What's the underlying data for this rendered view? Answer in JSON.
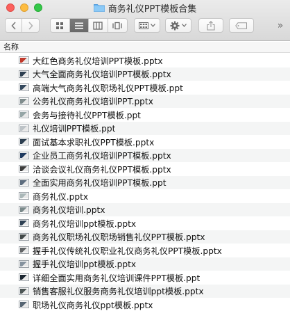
{
  "window": {
    "title": "商务礼仪PPT模板合集",
    "close_label": "close",
    "minimize_label": "minimize",
    "zoom_label": "zoom"
  },
  "toolbar": {
    "back_icon": "chevron-left-icon",
    "forward_icon": "chevron-right-icon",
    "view_modes": [
      "icon-view-icon",
      "list-view-icon",
      "column-view-icon",
      "cover-flow-icon"
    ],
    "active_view": "list",
    "arrange_icon": "arrange-grid-icon",
    "action_icon": "gear-icon",
    "share_icon": "share-icon",
    "tags_icon": "tag-icon",
    "overflow_label": "»"
  },
  "columns": {
    "name_header": "名称"
  },
  "files": [
    {
      "name": "大红色商务礼仪培训PPT模板.pptx",
      "thumb": "#c0392b"
    },
    {
      "name": "大气全面商务礼仪培训PPT模板.pptx",
      "thumb": "#2c3e50"
    },
    {
      "name": "高端大气商务礼仪职场礼仪PPT模板.ppt",
      "thumb": "#34495e"
    },
    {
      "name": "公务礼仪商务礼仪培训PPT.pptx",
      "thumb": "#7f8c8d"
    },
    {
      "name": "会务与接待礼仪PPT模板.ppt",
      "thumb": "#95a5a6"
    },
    {
      "name": "礼仪培训PPT模板.ppt",
      "thumb": "#bdc3c7"
    },
    {
      "name": "面试基本求职礼仪PPT模板.pptx",
      "thumb": "#2c3e50"
    },
    {
      "name": "企业员工商务礼仪培训PPT模板.pptx",
      "thumb": "#1e3a5f"
    },
    {
      "name": "洽谈会议礼仪商务礼仪PPT模板.pptx",
      "thumb": "#3d3d3d"
    },
    {
      "name": "全面实用商务礼仪培训PPT模板.ppt",
      "thumb": "#5d6d7e"
    },
    {
      "name": "商务礼仪.pptx",
      "thumb": "#aab7b8"
    },
    {
      "name": "商务礼仪培训.pptx",
      "thumb": "#7b8a8b"
    },
    {
      "name": "商务礼仪培训ppt模板.pptx",
      "thumb": "#2e4053"
    },
    {
      "name": "商务礼仪职场礼仪职场销售礼仪PPT模板.pptx",
      "thumb": "#424949"
    },
    {
      "name": "握手礼仪传统礼仪职业礼仪商务礼仪PPT模板.pptx",
      "thumb": "#626567"
    },
    {
      "name": "握手礼仪培训ppt模板.pptx",
      "thumb": "#85929e"
    },
    {
      "name": "详细全面实用商务礼仪培训课件PPT模板.ppt",
      "thumb": "#1b2631"
    },
    {
      "name": "销售客服礼仪服务商务礼仪培训ppt模板.pptx",
      "thumb": "#4d5656"
    },
    {
      "name": "职场礼仪商务礼仪ppt模板.pptx",
      "thumb": "#566573"
    }
  ]
}
